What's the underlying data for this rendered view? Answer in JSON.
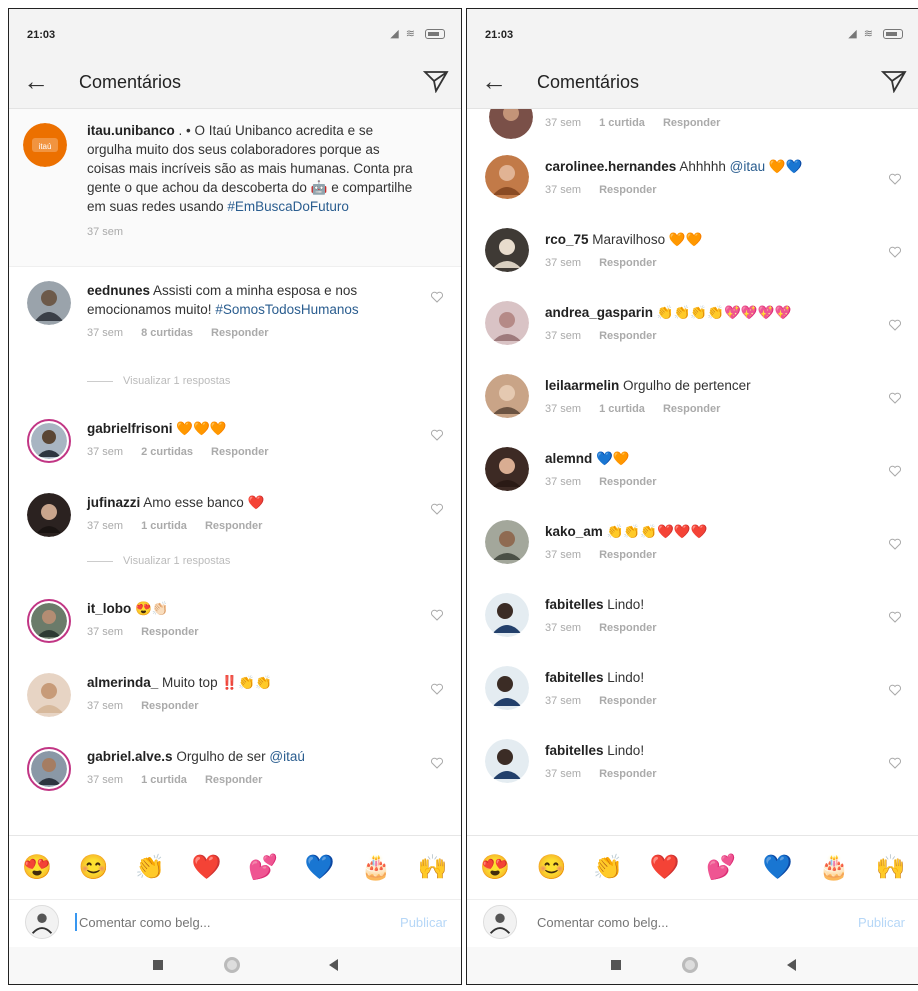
{
  "status_time": "21:03",
  "header_title": "Comentários",
  "left": {
    "caption": {
      "user": "itau.unibanco",
      "text": " . • O Itaú Unibanco acredita e se orgulha muito dos seus colaboradores porque as coisas mais incríveis são as mais humanas. Conta pra gente o que achou da descoberta do 🤖 e compartilhe em suas redes usando ",
      "hashtag": "#EmBuscaDoFuturo",
      "time": "37 sem"
    },
    "comments": [
      {
        "user": "eednunes",
        "text": " Assisti com a minha esposa e nos emocionamos muito! ",
        "hashtag": "#SomosTodosHumanos",
        "time": "37 sem",
        "likes": "8 curtidas",
        "reply": "Responder"
      },
      {
        "user": "gabrielfrisoni",
        "text": " 🧡🧡🧡",
        "time": "37 sem",
        "likes": "2 curtidas",
        "reply": "Responder"
      },
      {
        "user": "jufinazzi",
        "text": " Amo esse banco ❤️",
        "time": "37 sem",
        "likes": "1 curtida",
        "reply": "Responder"
      },
      {
        "user": "it_lobo",
        "text": " 😍👏🏻",
        "time": "37 sem",
        "reply": "Responder"
      },
      {
        "user": "almerinda_",
        "text": " Muito top ‼️👏👏",
        "time": "37 sem",
        "reply": "Responder"
      },
      {
        "user": "gabriel.alve.s",
        "text": " Orgulho de ser ",
        "mention": "@itaú",
        "time": "37 sem",
        "likes": "1 curtida",
        "reply": "Responder"
      }
    ],
    "view_replies_1": "Visualizar 1 respostas",
    "view_replies_2": "Visualizar 1 respostas"
  },
  "right": {
    "partial": {
      "time": "37 sem",
      "likes": "1 curtida",
      "reply": "Responder"
    },
    "comments": [
      {
        "user": "carolinee.hernandes",
        "text": " Ahhhhh ",
        "mention": "@itau",
        "tail": " 🧡💙",
        "time": "37 sem",
        "reply": "Responder"
      },
      {
        "user": "rco_75",
        "text": " Maravilhoso 🧡🧡",
        "time": "37 sem",
        "reply": "Responder"
      },
      {
        "user": "andrea_gasparin",
        "text": " 👏👏👏👏💖💖💖💖",
        "time": "37 sem",
        "reply": "Responder"
      },
      {
        "user": "leilaarmelin",
        "text": " Orgulho de pertencer",
        "time": "37 sem",
        "likes": "1 curtida",
        "reply": "Responder"
      },
      {
        "user": "alemnd",
        "text": " 💙🧡",
        "time": "37 sem",
        "reply": "Responder"
      },
      {
        "user": "kako_am",
        "text": " 👏👏👏❤️❤️❤️",
        "time": "37 sem",
        "reply": "Responder"
      },
      {
        "user": "fabitelles",
        "text": " Lindo!",
        "time": "37 sem",
        "reply": "Responder"
      },
      {
        "user": "fabitelles",
        "text": " Lindo!",
        "time": "37 sem",
        "reply": "Responder"
      },
      {
        "user": "fabitelles",
        "text": " Lindo!",
        "time": "37 sem",
        "reply": "Responder"
      }
    ]
  },
  "emoji_bar": [
    "😍",
    "😊",
    "👏",
    "❤️",
    "💕",
    "💙",
    "🎂",
    "🙌"
  ],
  "composer_placeholder": "Comentar como belg...",
  "publish_label": "Publicar",
  "colors": {
    "accent": "#3897f0",
    "mention": "#2a5d8f",
    "ring": "#c13584",
    "itau_orange": "#ec7000"
  }
}
